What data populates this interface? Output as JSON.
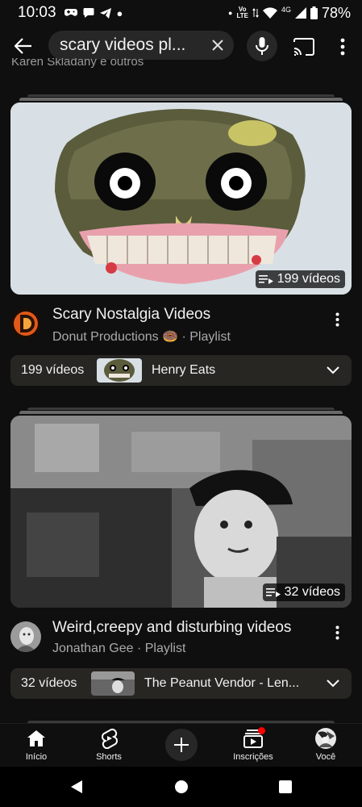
{
  "status_bar": {
    "time": "10:03",
    "network_label": "4G",
    "volte_label": "Vo₄ LTE",
    "battery": "78%"
  },
  "search": {
    "query": "scary videos pl..."
  },
  "cutoff_text": "Karen Skladany e outros",
  "playlists": [
    {
      "title": "Scary Nostalgia Videos",
      "channel": "Donut Productions 🍩 · Playlist",
      "badge": "199 vídeos",
      "strip_count": "199 vídeos",
      "strip_video_title": "Henry Eats"
    },
    {
      "title": "Weird,creepy and disturbing videos",
      "channel": "Jonathan Gee · Playlist",
      "badge": "32 vídeos",
      "strip_count": "32 vídeos",
      "strip_video_title": "The Peanut Vendor - Len..."
    }
  ],
  "bottom_nav": {
    "home": "Início",
    "shorts": "Shorts",
    "subscriptions": "Inscrições",
    "you": "Você"
  },
  "colors": {
    "background": "#0f0f0f",
    "chip": "#272727",
    "strip": "#272623",
    "notification_dot": "#ff0000"
  },
  "icons": [
    "back-arrow-icon",
    "clear-icon",
    "mic-icon",
    "cast-icon",
    "more-vert-icon",
    "playlist-icon",
    "chevron-down-icon",
    "home-icon",
    "shorts-icon",
    "create-icon",
    "subscriptions-icon",
    "avatar"
  ]
}
